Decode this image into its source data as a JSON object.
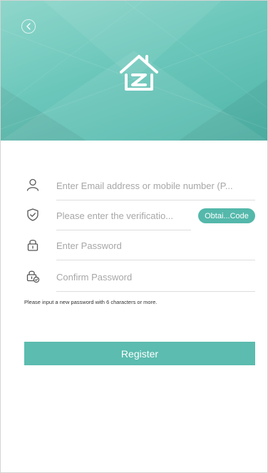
{
  "header": {
    "back_icon": "chevron-left-icon",
    "logo_icon": "home-z-logo-icon"
  },
  "form": {
    "email": {
      "icon": "user-icon",
      "placeholder": "Enter Email address or mobile number (P...",
      "value": ""
    },
    "code": {
      "icon": "shield-check-icon",
      "placeholder": "Please enter the verificatio...",
      "value": "",
      "button_label": "Obtai...Code"
    },
    "password": {
      "icon": "lock-icon",
      "placeholder": "Enter Password",
      "value": ""
    },
    "confirm": {
      "icon": "lock-check-icon",
      "placeholder": "Confirm Password",
      "value": ""
    },
    "hint": "Please input a new password with 6 characters or more.",
    "register_label": "Register"
  },
  "colors": {
    "accent": "#5bbcaf",
    "header_light": "#8fd6cb",
    "header_dark": "#4fb5a8",
    "divider": "#dddddd",
    "placeholder": "#a7a7a7"
  }
}
